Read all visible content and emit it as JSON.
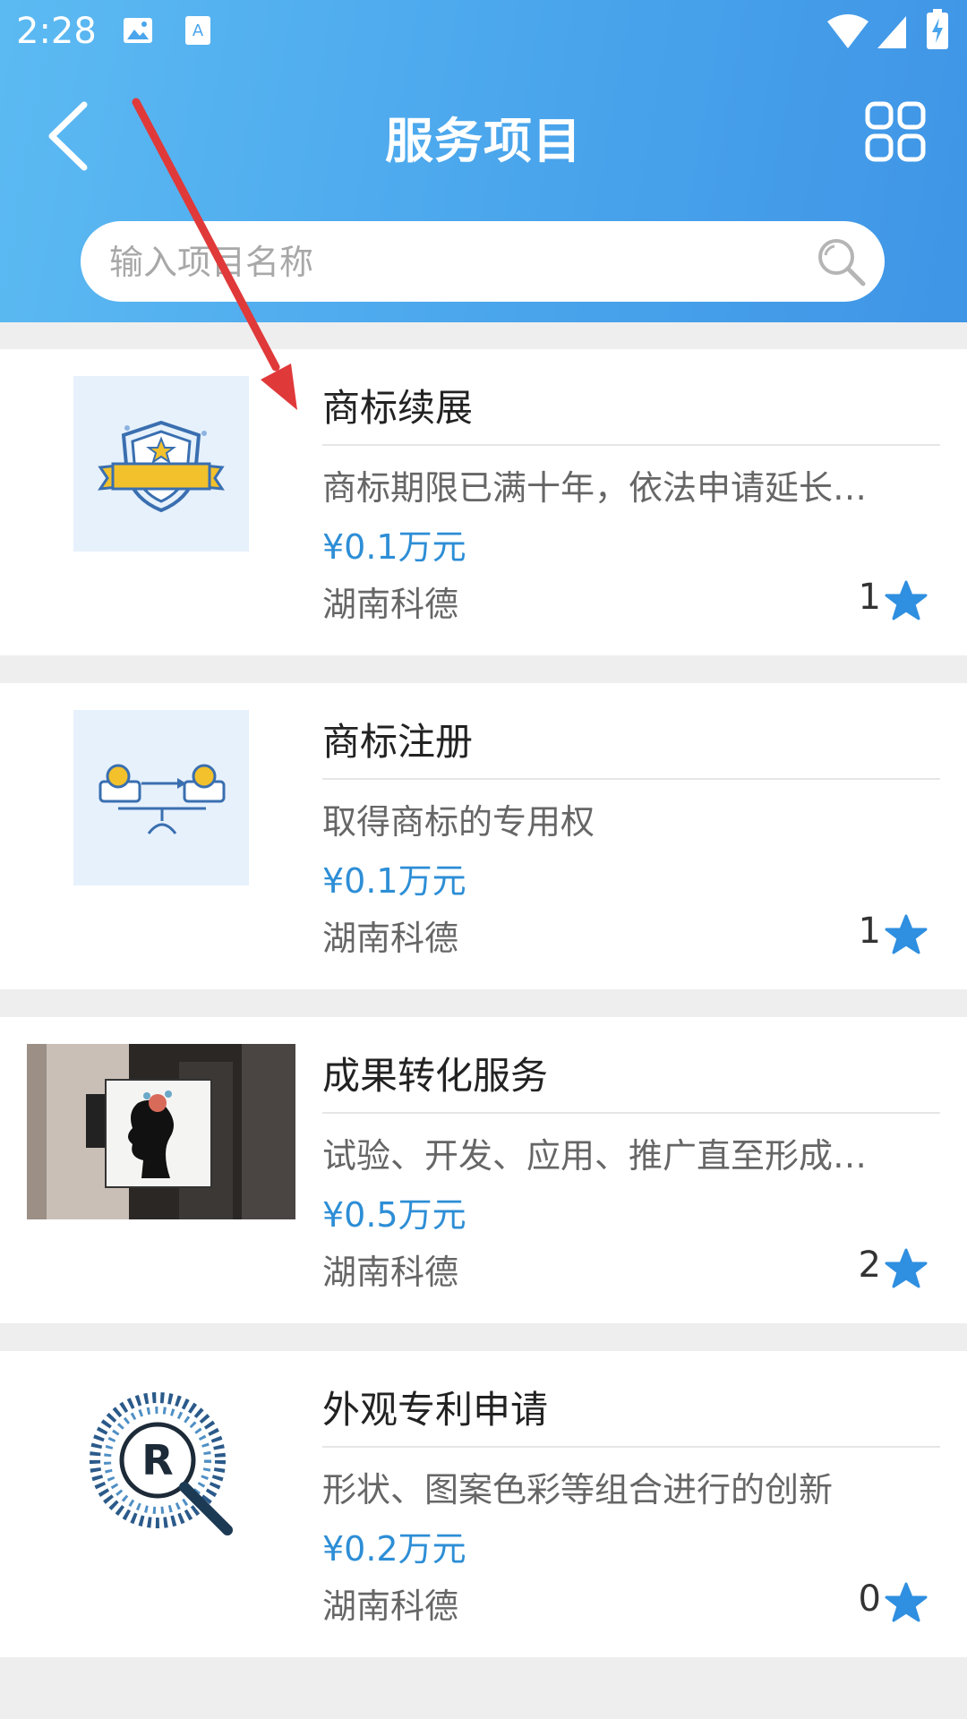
{
  "status_bar": {
    "time": "2:28"
  },
  "header": {
    "title": "服务项目",
    "search_placeholder": "输入项目名称"
  },
  "services": [
    {
      "name": "商标续展",
      "description": "商标期限已满十年，依法申请延长…",
      "price": "¥0.1万元",
      "company": "湖南科德",
      "favorites": "1"
    },
    {
      "name": "商标注册",
      "description": "取得商标的专用权",
      "price": "¥0.1万元",
      "company": "湖南科德",
      "favorites": "1"
    },
    {
      "name": "成果转化服务",
      "description": "试验、开发、应用、推广直至形成…",
      "price": "¥0.5万元",
      "company": "湖南科德",
      "favorites": "2"
    },
    {
      "name": "外观专利申请",
      "description": "形状、图案色彩等组合进行的创新",
      "price": "¥0.2万元",
      "company": "湖南科德",
      "favorites": "0"
    }
  ],
  "colors": {
    "header_blue": "#4aa5ec",
    "price_blue": "#2d8ed6",
    "star_blue": "#2f8fe0",
    "annotation_arrow": "#e0393a"
  },
  "icons": {
    "back": "chevron-left-icon",
    "menu": "grid-icon",
    "search": "search-icon",
    "favorite": "star-icon"
  }
}
